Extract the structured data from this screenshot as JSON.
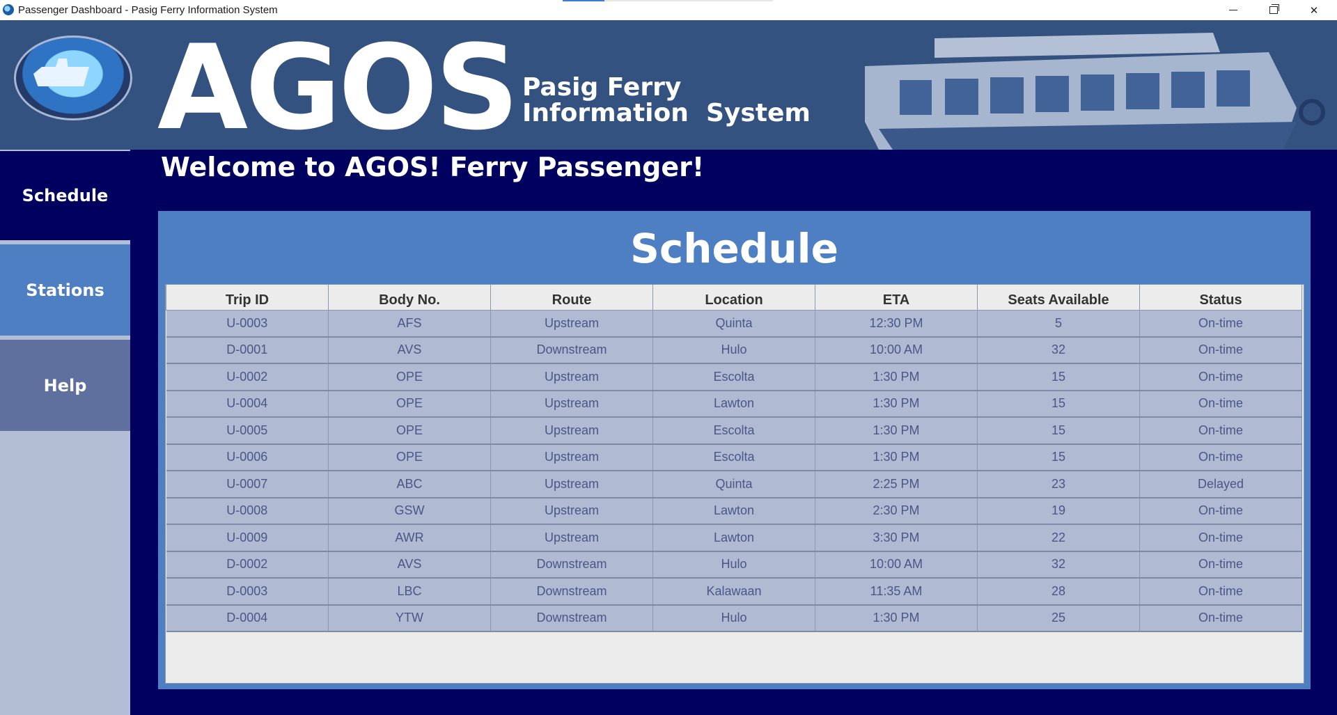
{
  "window": {
    "title": "Passenger Dashboard - Pasig Ferry Information System"
  },
  "banner": {
    "brand": "AGOS",
    "subtitle": "Pasig Ferry\nInformation  System"
  },
  "sidebar": {
    "items": [
      {
        "label": "Schedule",
        "active": true
      },
      {
        "label": "Stations",
        "active": false
      },
      {
        "label": "Help",
        "active": false
      }
    ]
  },
  "main": {
    "welcome": "Welcome to AGOS! Ferry Passenger!",
    "panel_title": "Schedule",
    "table": {
      "columns": [
        "Trip ID",
        "Body No.",
        "Route",
        "Location",
        "ETA",
        "Seats Available",
        "Status"
      ],
      "rows": [
        [
          "U-0003",
          "AFS",
          "Upstream",
          "Quinta",
          "12:30 PM",
          "5",
          "On-time"
        ],
        [
          "D-0001",
          "AVS",
          "Downstream",
          "Hulo",
          "10:00 AM",
          "32",
          "On-time"
        ],
        [
          "U-0002",
          "OPE",
          "Upstream",
          "Escolta",
          "1:30 PM",
          "15",
          "On-time"
        ],
        [
          "U-0004",
          "OPE",
          "Upstream",
          "Lawton",
          "1:30 PM",
          "15",
          "On-time"
        ],
        [
          "U-0005",
          "OPE",
          "Upstream",
          "Escolta",
          "1:30 PM",
          "15",
          "On-time"
        ],
        [
          "U-0006",
          "OPE",
          "Upstream",
          "Escolta",
          "1:30 PM",
          "15",
          "On-time"
        ],
        [
          "U-0007",
          "ABC",
          "Upstream",
          "Quinta",
          "2:25 PM",
          "23",
          "Delayed"
        ],
        [
          "U-0008",
          "GSW",
          "Upstream",
          "Lawton",
          "2:30 PM",
          "19",
          "On-time"
        ],
        [
          "U-0009",
          "AWR",
          "Upstream",
          "Lawton",
          "3:30 PM",
          "22",
          "On-time"
        ],
        [
          "D-0002",
          "AVS",
          "Downstream",
          "Hulo",
          "10:00 AM",
          "32",
          "On-time"
        ],
        [
          "D-0003",
          "LBC",
          "Downstream",
          "Kalawaan",
          "11:35 AM",
          "28",
          "On-time"
        ],
        [
          "D-0004",
          "YTW",
          "Downstream",
          "Hulo",
          "1:30 PM",
          "25",
          "On-time"
        ]
      ]
    }
  },
  "colors": {
    "banner": "#34527f",
    "background": "#00005e",
    "panel": "#4e7fc2",
    "row": "#b0bbd3"
  }
}
